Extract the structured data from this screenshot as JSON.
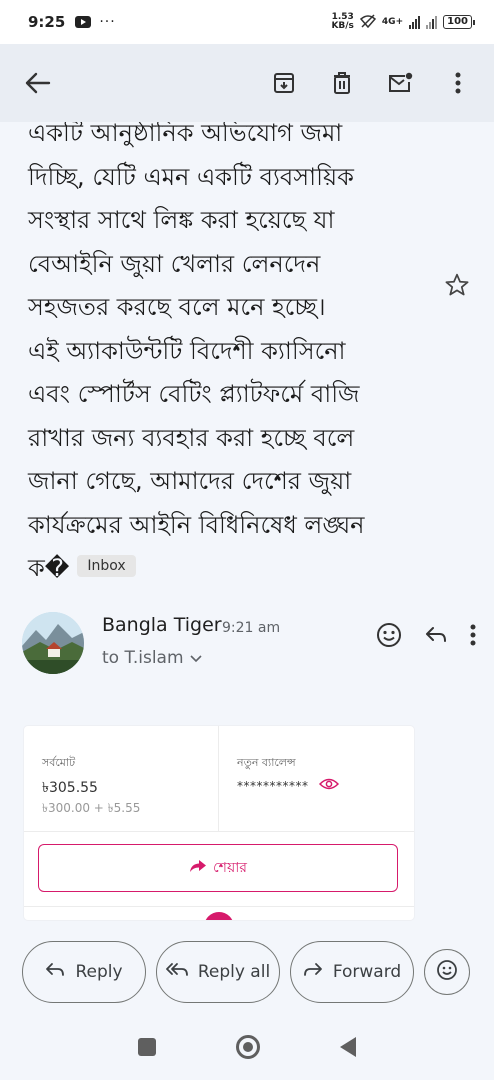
{
  "status_bar": {
    "time": "9:25",
    "more": "···",
    "speed_value": "1.53",
    "speed_unit": "KB/s",
    "network": "4G+",
    "battery": "100"
  },
  "app_bar": {
    "back_icon": "arrow-back-icon",
    "archive_icon": "archive-icon",
    "delete_icon": "delete-icon",
    "mark_unread_icon": "mark-unread-icon",
    "more_icon": "more-vert-icon"
  },
  "message": {
    "body_lines": [
      "একটি আনুষ্ঠানিক অভিযোগ জমা",
      "দিচ্ছি, যেটি এমন একটি ব্যবসায়িক",
      "সংস্থার সাথে লিঙ্ক করা হয়েছে যা",
      "বেআইনি জুয়া খেলার লেনদেন",
      "সহজতর করছে বলে মনে হচ্ছে।",
      "এই অ্যাকাউন্টটি বিদেশী ক্যাসিনো",
      "এবং স্পোর্টস বেটিং প্ল্যাটফর্মে বাজি",
      "রাখার জন্য ব্যবহার করা হচ্ছে বলে",
      "জানা গেছে, আমাদের দেশের জুয়া",
      "কার্যক্রমের আইনি বিধিনিষেধ লঙ্ঘন"
    ],
    "last_line": "ক�",
    "label_chip": "Inbox",
    "star_icon": "star-outline-icon"
  },
  "sender": {
    "name": "Bangla Tiger",
    "time": "9:21 am",
    "to": "to T.islam",
    "avatar_icon": "landscape-avatar-icon"
  },
  "card": {
    "total_label": "সর্বমোট",
    "total_amount": "৳305.55",
    "total_breakdown": "৳300.00 + ৳5.55",
    "balance_label": "নতুন ব্যালেন্স",
    "balance_masked": "***********",
    "share_label": "শেয়ার",
    "accent_color": "#d61a6b"
  },
  "actions": {
    "reply": "Reply",
    "reply_all": "Reply all",
    "forward": "Forward"
  }
}
